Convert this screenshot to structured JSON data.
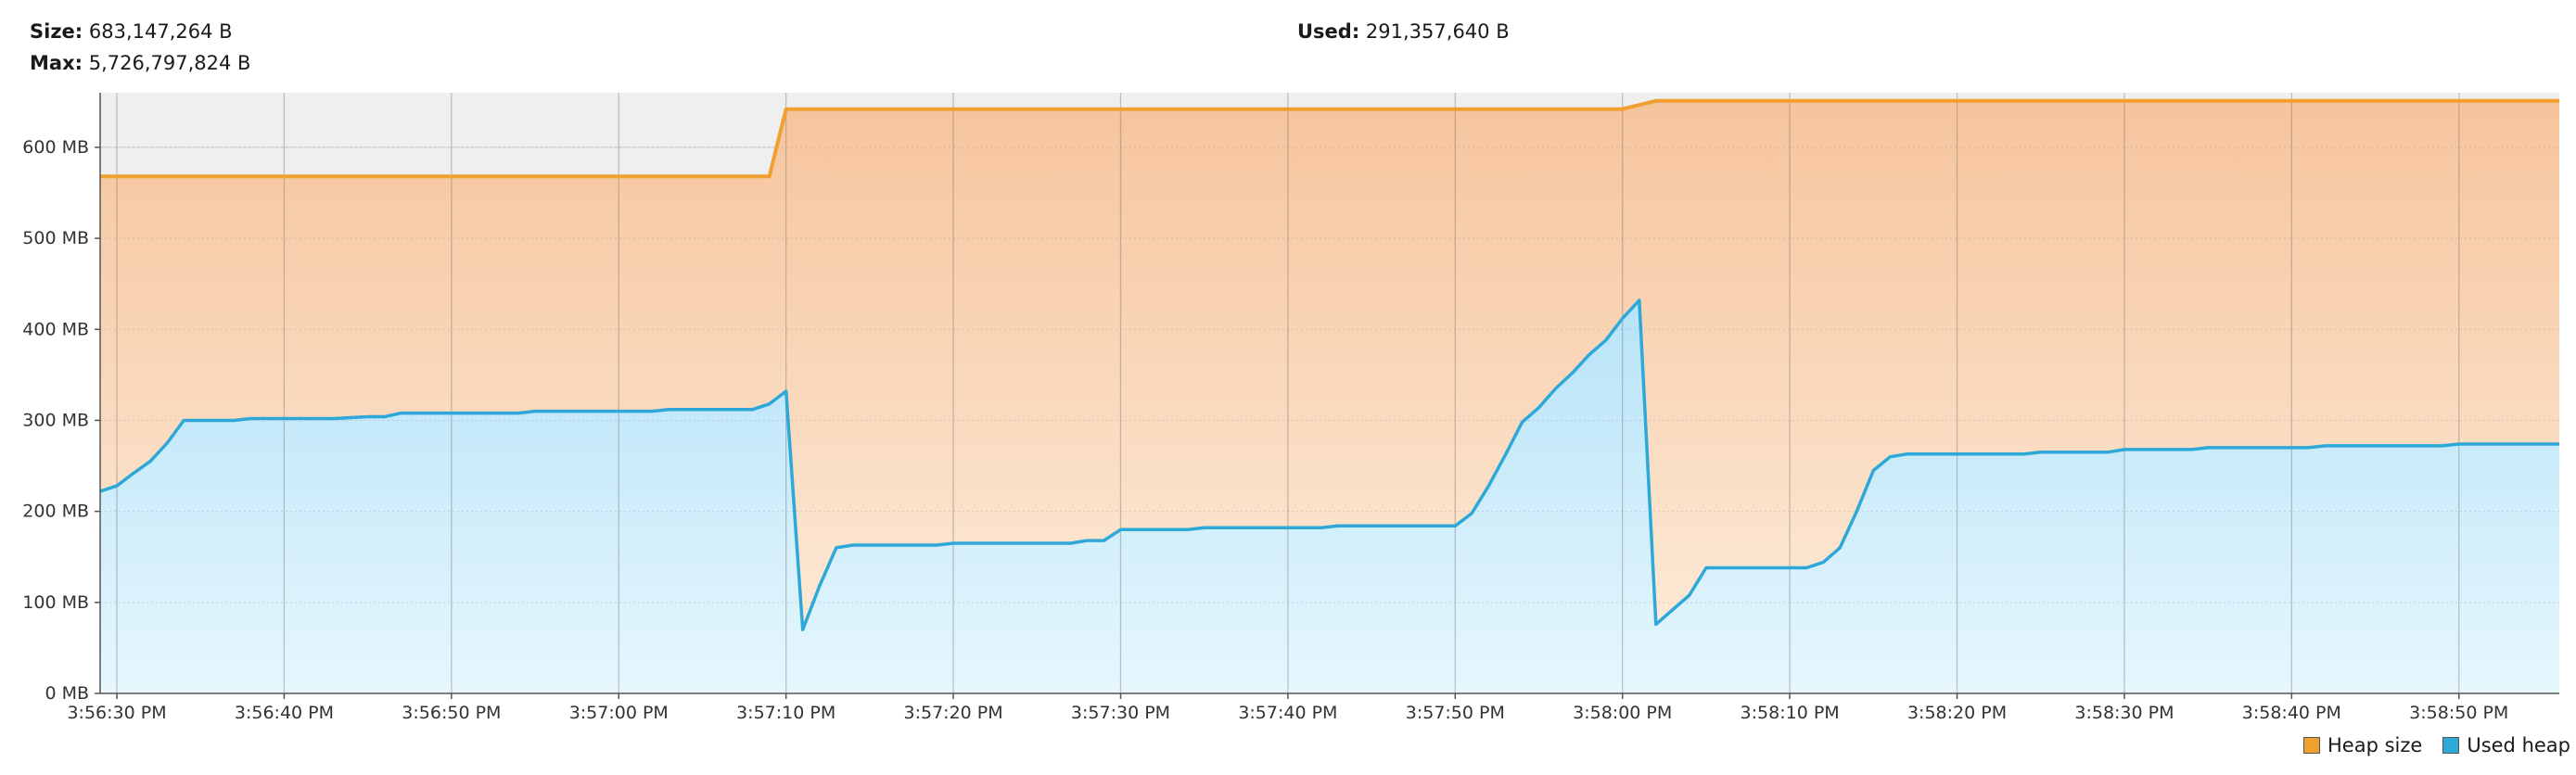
{
  "stats": {
    "size_label": "Size:",
    "size_value": "683,147,264 B",
    "max_label": "Max:",
    "max_value": "5,726,797,824 B",
    "used_label": "Used:",
    "used_value": "291,357,640 B"
  },
  "colors": {
    "heap_size_line": "#f0a030",
    "used_heap_line": "#2ea8d8",
    "heap_size_fill_top": "#f6c49c",
    "heap_size_fill_bottom": "#fdeedd",
    "used_heap_fill_top": "#b7e3f8",
    "used_heap_fill_bottom": "#e6f7fd",
    "plot_background": "#efefef"
  },
  "chart_data": {
    "type": "area",
    "ylim": [
      0,
      660
    ],
    "y_unit": "MB",
    "y_ticks": [
      {
        "value": 0,
        "label": "0 MB"
      },
      {
        "value": 100,
        "label": "100 MB"
      },
      {
        "value": 200,
        "label": "200 MB"
      },
      {
        "value": 300,
        "label": "300 MB"
      },
      {
        "value": 400,
        "label": "400 MB"
      },
      {
        "value": 500,
        "label": "500 MB"
      },
      {
        "value": 600,
        "label": "600 MB"
      }
    ],
    "x_range": [
      "3:56:29 PM",
      "3:58:56 PM"
    ],
    "x_ticks": [
      "3:56:30 PM",
      "3:56:40 PM",
      "3:56:50 PM",
      "3:57:00 PM",
      "3:57:10 PM",
      "3:57:20 PM",
      "3:57:30 PM",
      "3:57:40 PM",
      "3:57:50 PM",
      "3:58:00 PM",
      "3:58:10 PM",
      "3:58:20 PM",
      "3:58:30 PM",
      "3:58:40 PM",
      "3:58:50 PM"
    ],
    "grid": true,
    "legend_position": "bottom-right",
    "series": [
      {
        "name": "Heap size",
        "points": [
          [
            "3:56:29 PM",
            568
          ],
          [
            "3:57:09 PM",
            568
          ],
          [
            "3:57:10 PM",
            642
          ],
          [
            "3:58:00 PM",
            642
          ],
          [
            "3:58:02 PM",
            651
          ],
          [
            "3:58:56 PM",
            651
          ]
        ]
      },
      {
        "name": "Used heap",
        "points": [
          [
            "3:56:29 PM",
            222
          ],
          [
            "3:56:30 PM",
            228
          ],
          [
            "3:56:31 PM",
            242
          ],
          [
            "3:56:32 PM",
            255
          ],
          [
            "3:56:33 PM",
            275
          ],
          [
            "3:56:34 PM",
            300
          ],
          [
            "3:56:37 PM",
            300
          ],
          [
            "3:56:38 PM",
            302
          ],
          [
            "3:56:43 PM",
            302
          ],
          [
            "3:56:45 PM",
            304
          ],
          [
            "3:56:46 PM",
            304
          ],
          [
            "3:56:47 PM",
            308
          ],
          [
            "3:56:54 PM",
            308
          ],
          [
            "3:56:55 PM",
            310
          ],
          [
            "3:57:02 PM",
            310
          ],
          [
            "3:57:03 PM",
            312
          ],
          [
            "3:57:08 PM",
            312
          ],
          [
            "3:57:09 PM",
            318
          ],
          [
            "3:57:10 PM",
            332
          ],
          [
            "3:57:11 PM",
            70
          ],
          [
            "3:57:12 PM",
            118
          ],
          [
            "3:57:13 PM",
            160
          ],
          [
            "3:57:14 PM",
            163
          ],
          [
            "3:57:19 PM",
            163
          ],
          [
            "3:57:20 PM",
            165
          ],
          [
            "3:57:27 PM",
            165
          ],
          [
            "3:57:28 PM",
            168
          ],
          [
            "3:57:29 PM",
            168
          ],
          [
            "3:57:30 PM",
            180
          ],
          [
            "3:57:34 PM",
            180
          ],
          [
            "3:57:35 PM",
            182
          ],
          [
            "3:57:42 PM",
            182
          ],
          [
            "3:57:43 PM",
            184
          ],
          [
            "3:57:50 PM",
            184
          ],
          [
            "3:57:51 PM",
            198
          ],
          [
            "3:57:52 PM",
            228
          ],
          [
            "3:57:53 PM",
            262
          ],
          [
            "3:57:54 PM",
            298
          ],
          [
            "3:57:55 PM",
            314
          ],
          [
            "3:57:56 PM",
            335
          ],
          [
            "3:57:57 PM",
            352
          ],
          [
            "3:57:58 PM",
            372
          ],
          [
            "3:57:59 PM",
            388
          ],
          [
            "3:58:00 PM",
            412
          ],
          [
            "3:58:01 PM",
            432
          ],
          [
            "3:58:02 PM",
            76
          ],
          [
            "3:58:04 PM",
            108
          ],
          [
            "3:58:05 PM",
            138
          ],
          [
            "3:58:11 PM",
            138
          ],
          [
            "3:58:12 PM",
            144
          ],
          [
            "3:58:13 PM",
            160
          ],
          [
            "3:58:14 PM",
            200
          ],
          [
            "3:58:15 PM",
            245
          ],
          [
            "3:58:16 PM",
            260
          ],
          [
            "3:58:17 PM",
            263
          ],
          [
            "3:58:24 PM",
            263
          ],
          [
            "3:58:25 PM",
            265
          ],
          [
            "3:58:29 PM",
            265
          ],
          [
            "3:58:30 PM",
            268
          ],
          [
            "3:58:34 PM",
            268
          ],
          [
            "3:58:35 PM",
            270
          ],
          [
            "3:58:41 PM",
            270
          ],
          [
            "3:58:42 PM",
            272
          ],
          [
            "3:58:49 PM",
            272
          ],
          [
            "3:58:50 PM",
            274
          ],
          [
            "3:58:56 PM",
            274
          ]
        ]
      }
    ]
  },
  "legend": {
    "heap_size_label": "Heap size",
    "used_heap_label": "Used heap"
  }
}
